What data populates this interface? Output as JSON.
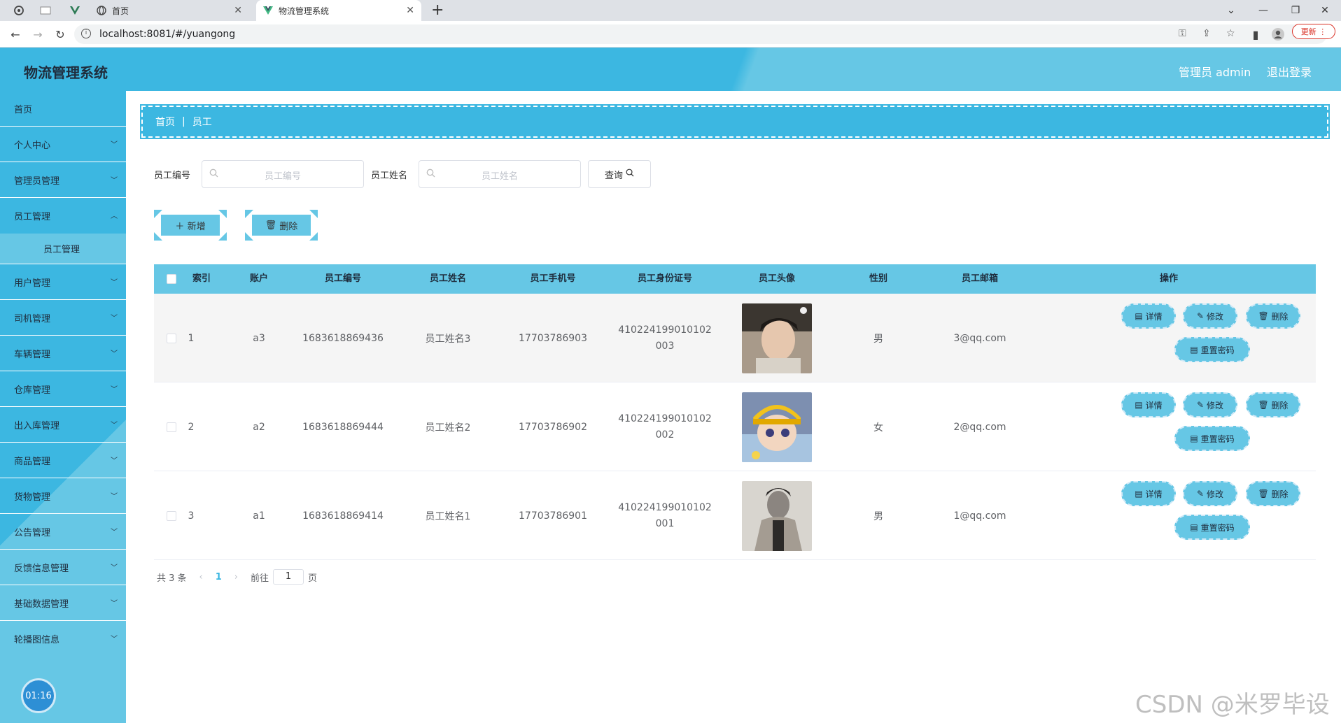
{
  "browser": {
    "tabs": [
      {
        "title": "首页",
        "active": false
      },
      {
        "title": "物流管理系统",
        "active": true
      }
    ],
    "url": "localhost:8081/#/yuangong",
    "update_label": "更新"
  },
  "header": {
    "title": "物流管理系统",
    "user_label": "管理员 admin",
    "logout_label": "退出登录"
  },
  "sidebar": {
    "items": [
      {
        "label": "首页"
      },
      {
        "label": "个人中心"
      },
      {
        "label": "管理员管理"
      },
      {
        "label": "员工管理"
      },
      {
        "label": "员工管理",
        "sub": true
      },
      {
        "label": "用户管理"
      },
      {
        "label": "司机管理"
      },
      {
        "label": "车辆管理"
      },
      {
        "label": "仓库管理"
      },
      {
        "label": "出入库管理"
      },
      {
        "label": "商品管理"
      },
      {
        "label": "货物管理"
      },
      {
        "label": "公告管理"
      },
      {
        "label": "反馈信息管理"
      },
      {
        "label": "基础数据管理"
      },
      {
        "label": "轮播图信息"
      }
    ],
    "clock": "01:16"
  },
  "breadcrumb": {
    "home": "首页",
    "current": "员工"
  },
  "search": {
    "field1_label": "员工编号",
    "field1_placeholder": "员工编号",
    "field2_label": "员工姓名",
    "field2_placeholder": "员工姓名",
    "query_label": "查询"
  },
  "actions": {
    "add_label": "新增",
    "delete_label": "删除"
  },
  "table": {
    "columns": [
      "索引",
      "账户",
      "员工编号",
      "员工姓名",
      "员工手机号",
      "员工身份证号",
      "员工头像",
      "性别",
      "员工邮箱",
      "操作"
    ],
    "rows": [
      {
        "index": "1",
        "account": "a3",
        "emp_no": "1683618869436",
        "name": "员工姓名3",
        "phone": "17703786903",
        "id_line1": "410224199010102",
        "id_line2": "003",
        "gender": "男",
        "email": "3@qq.com"
      },
      {
        "index": "2",
        "account": "a2",
        "emp_no": "1683618869444",
        "name": "员工姓名2",
        "phone": "17703786902",
        "id_line1": "410224199010102",
        "id_line2": "002",
        "gender": "女",
        "email": "2@qq.com"
      },
      {
        "index": "3",
        "account": "a1",
        "emp_no": "1683618869414",
        "name": "员工姓名1",
        "phone": "17703786901",
        "id_line1": "410224199010102",
        "id_line2": "001",
        "gender": "男",
        "email": "1@qq.com"
      }
    ],
    "op_labels": {
      "detail": "详情",
      "edit": "修改",
      "delete": "删除",
      "reset": "重置密码"
    }
  },
  "pagination": {
    "total": "共 3 条",
    "page": "1",
    "goto_prefix": "前往",
    "goto_value": "1",
    "goto_suffix": "页"
  },
  "watermark": "CSDN @米罗毕设",
  "colors": {
    "primary": "#3cb7e1",
    "secondary": "#66c7e5",
    "text_dark": "#1f2d3d"
  }
}
